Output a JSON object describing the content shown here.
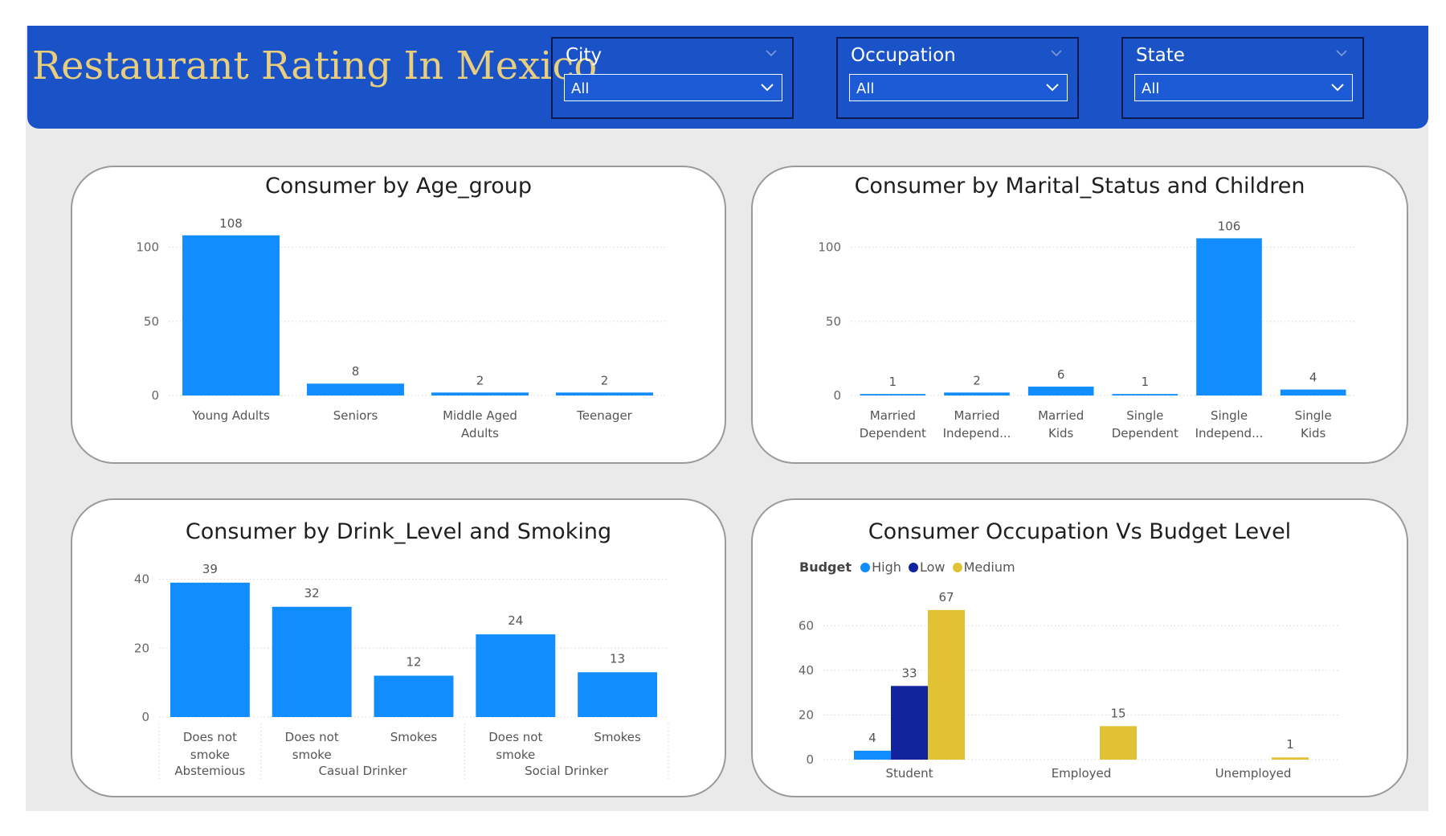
{
  "header": {
    "title": "Restaurant Rating In Mexico",
    "slicers": [
      {
        "label": "City",
        "value": "All"
      },
      {
        "label": "Occupation",
        "value": "All"
      },
      {
        "label": "State",
        "value": "All"
      }
    ]
  },
  "colors": {
    "header_bg": "#1a52c7",
    "title": "#e9cf7d",
    "bar": "#118dff",
    "high": "#118dff",
    "low": "#12239e",
    "medium": "#e0c234",
    "canvas": "#eaeaea"
  },
  "icons": {
    "collapse": "chevron-down-icon",
    "dropdown": "chevron-down-icon"
  },
  "chart_data": [
    {
      "type": "bar",
      "title": "Consumer by Age_group",
      "categories": [
        "Young Adults",
        "Seniors",
        "Middle Aged Adults",
        "Teenager"
      ],
      "values": [
        108,
        8,
        2,
        2
      ],
      "yticks": [
        0,
        50,
        100
      ],
      "ylim": [
        0,
        116
      ]
    },
    {
      "type": "bar",
      "title": "Consumer by Marital_Status and Children",
      "categories": [
        "Married Dependent",
        "Married Independ...",
        "Married Kids",
        "Single Dependent",
        "Single Independ...",
        "Single Kids"
      ],
      "values": [
        1,
        2,
        6,
        1,
        106,
        4
      ],
      "yticks": [
        0,
        50,
        100
      ],
      "ylim": [
        0,
        116
      ]
    },
    {
      "type": "bar",
      "title": "Consumer by Drink_Level and Smoking",
      "groups": [
        {
          "name": "Abstemious",
          "categories": [
            "Does not smoke"
          ],
          "values": [
            39
          ]
        },
        {
          "name": "Casual Drinker",
          "categories": [
            "Does not smoke",
            "Smokes"
          ],
          "values": [
            32,
            12
          ]
        },
        {
          "name": "Social Drinker",
          "categories": [
            "Does not smoke",
            "Smokes"
          ],
          "values": [
            24,
            13
          ]
        }
      ],
      "yticks": [
        0,
        20,
        40
      ],
      "ylim": [
        0,
        42
      ]
    },
    {
      "type": "bar",
      "title": "Consumer Occupation Vs Budget Level",
      "legend_title": "Budget",
      "categories": [
        "Student",
        "Employed",
        "Unemployed"
      ],
      "series": [
        {
          "name": "High",
          "values": [
            4,
            null,
            null
          ]
        },
        {
          "name": "Low",
          "values": [
            33,
            null,
            null
          ]
        },
        {
          "name": "Medium",
          "values": [
            67,
            15,
            1
          ]
        }
      ],
      "yticks": [
        0,
        20,
        40,
        60
      ],
      "ylim": [
        0,
        72
      ]
    }
  ]
}
